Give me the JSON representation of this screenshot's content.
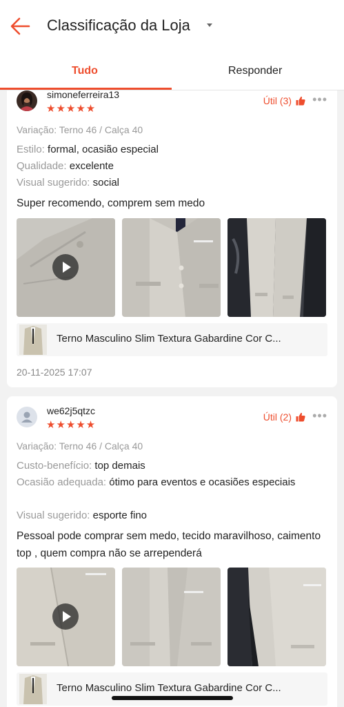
{
  "header": {
    "title": "Classificação da Loja"
  },
  "tabs": [
    {
      "label": "Tudo",
      "active": true
    },
    {
      "label": "Responder",
      "active": false
    }
  ],
  "colors": {
    "accent": "#ee4d2d",
    "muted": "#999999"
  },
  "reviews": [
    {
      "username": "simoneferreira13",
      "stars": "★★★★★",
      "rating": 5,
      "useful": "Útil (3)",
      "variation": "Variação: Terno 46 / Calça 40",
      "attributes": [
        {
          "key": "Estilo:",
          "value": "formal, ocasião especial"
        },
        {
          "key": "Qualidade:",
          "value": "excelente"
        },
        {
          "key": "Visual sugerido:",
          "value": "social"
        }
      ],
      "comment": "Super recomendo, comprem sem medo",
      "photos": [
        {
          "icon": "play-icon",
          "video": true
        },
        {
          "video": false
        },
        {
          "video": false
        }
      ],
      "product": "Terno Masculino Slim Textura Gabardine Cor C...",
      "date": "20-11-2025 17:07"
    },
    {
      "username": "we62j5qtzc",
      "stars": "★★★★★",
      "rating": 5,
      "useful": "Útil (2)",
      "variation": "Variação: Terno 46 / Calça 40",
      "attributes": [
        {
          "key": "Custo-benefício:",
          "value": "top demais"
        },
        {
          "key": "Ocasião adequada:",
          "value": "ótimo para eventos e ocasiões especiais"
        },
        {
          "key": "Visual sugerido:",
          "value": "esporte fino"
        }
      ],
      "comment": "Pessoal pode comprar sem medo, tecido maravilhoso, caimento top , quem compra não se arrependerá",
      "photos": [
        {
          "icon": "play-icon",
          "video": true
        },
        {
          "video": false
        },
        {
          "video": false
        }
      ],
      "product": "Terno Masculino Slim Textura Gabardine Cor C..."
    }
  ],
  "icons": [
    "back-arrow-icon",
    "dropdown-caret-icon",
    "thumbs-up-icon",
    "more-dots-icon",
    "play-icon",
    "default-avatar-icon"
  ]
}
